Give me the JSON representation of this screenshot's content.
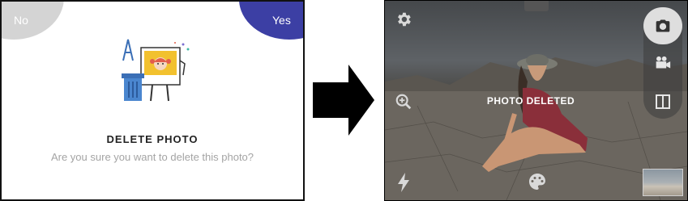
{
  "dialog": {
    "no_label": "No",
    "yes_label": "Yes",
    "title": "DELETE PHOTO",
    "message": "Are you sure you want to delete this photo?"
  },
  "camera": {
    "toast": "PHOTO DELETED",
    "top_left_icon": "settings-icon",
    "zoom_icon": "zoom-in-icon",
    "flash_icon": "flash-icon",
    "filter_icon": "palette-icon",
    "modes": [
      "photo-mode-icon",
      "video-mode-icon",
      "split-view-icon"
    ]
  },
  "colors": {
    "yes_button": "#3c3fa4",
    "no_button": "#d4d4d4",
    "title_text": "#222222",
    "message_text": "#a4a4a4"
  }
}
